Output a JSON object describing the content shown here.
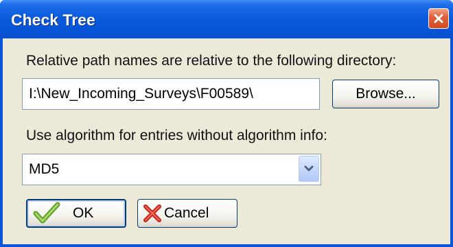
{
  "window": {
    "title": "Check Tree",
    "close_icon": "close-icon"
  },
  "directory": {
    "label": "Relative path names are relative to the following directory:",
    "value": "I:\\New_Incoming_Surveys\\F00589\\",
    "browse_label": "Browse..."
  },
  "algorithm": {
    "label": "Use algorithm for entries without algorithm info:",
    "selected": "MD5",
    "dropdown_icon": "chevron-down-icon"
  },
  "buttons": {
    "ok_label": "OK",
    "ok_icon": "checkmark-icon",
    "cancel_label": "Cancel",
    "cancel_icon": "x-cross-icon"
  },
  "colors": {
    "titlebar": "#0a5adc",
    "dialog_background": "#ece9d8",
    "close_button": "#d24a22"
  }
}
